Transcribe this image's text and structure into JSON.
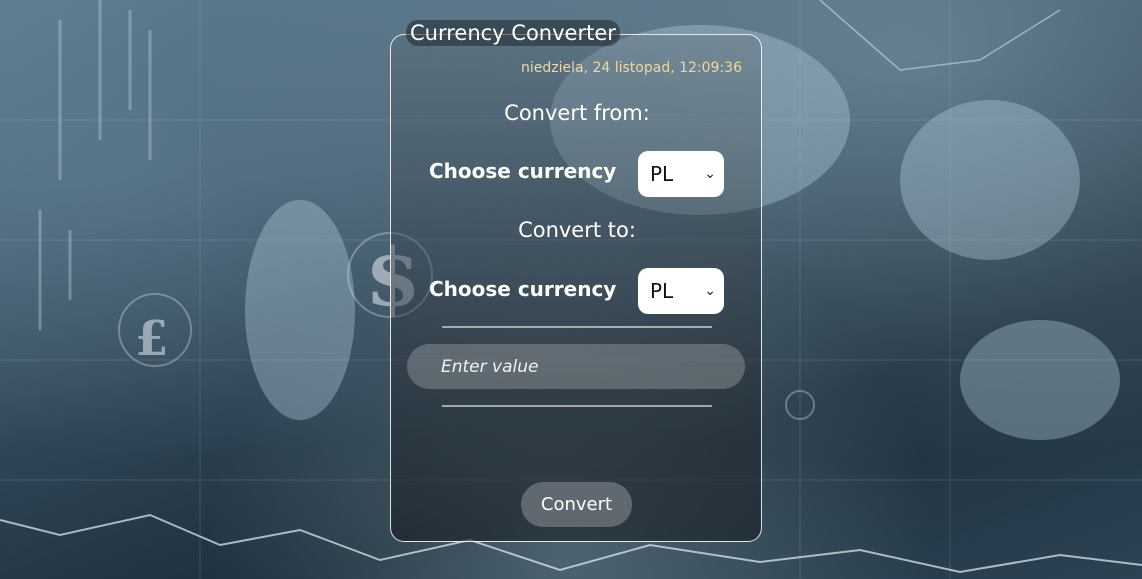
{
  "app": {
    "title": "Currency Converter",
    "datetime": "niedziela, 24 listopad, 12:09:36"
  },
  "from": {
    "heading": "Convert from:",
    "label": "Choose currency",
    "selected": "PL"
  },
  "to": {
    "heading": "Convert to:",
    "label": "Choose currency",
    "selected": "PL"
  },
  "input": {
    "placeholder": "Enter value",
    "value": ""
  },
  "actions": {
    "convert_label": "Convert"
  },
  "icons": {
    "select_chevron": "chevron-down-icon"
  },
  "colors": {
    "datetime": "#f0d79a",
    "card_border": "#ffffff",
    "text": "#ffffff"
  }
}
